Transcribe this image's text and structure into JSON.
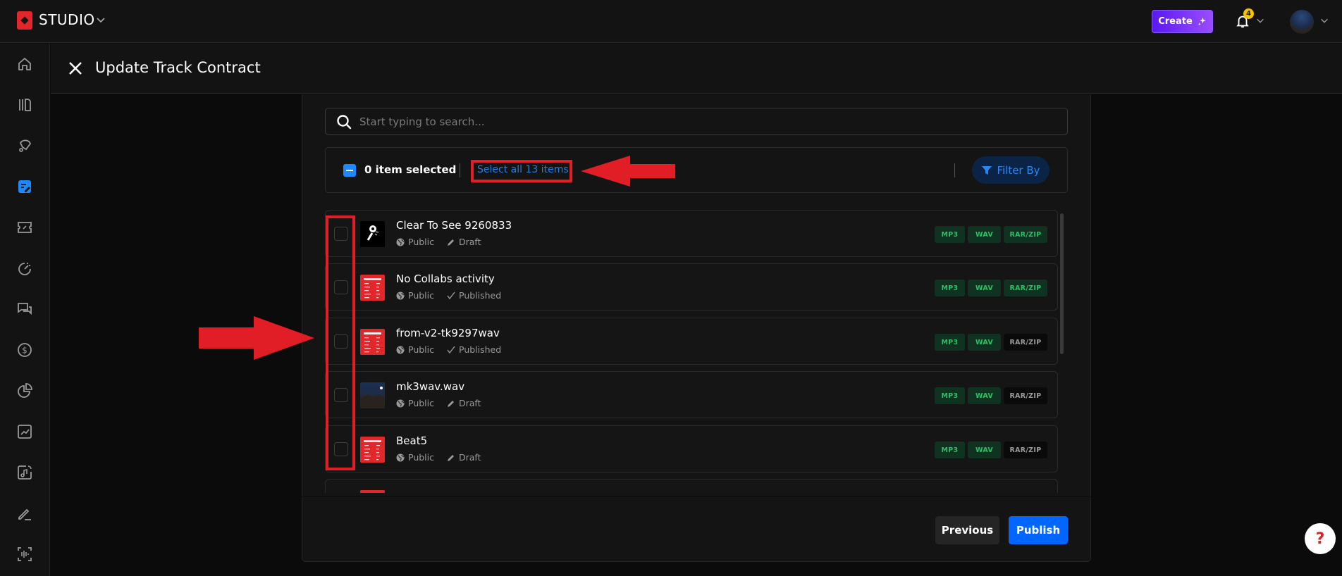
{
  "topbar": {
    "brand": "STUDIO",
    "create_label": "Create",
    "notification_count": "4"
  },
  "sidebar": {
    "items": [
      {
        "name": "home",
        "active": false
      },
      {
        "name": "library",
        "active": false
      },
      {
        "name": "promote",
        "active": false
      },
      {
        "name": "contracts",
        "active": true
      },
      {
        "name": "discounts",
        "active": false
      },
      {
        "name": "analytics",
        "active": false
      },
      {
        "name": "messages",
        "active": false
      },
      {
        "name": "sales",
        "active": false
      },
      {
        "name": "reports",
        "active": false
      },
      {
        "name": "growth",
        "active": false
      },
      {
        "name": "music",
        "active": false
      },
      {
        "name": "edit",
        "active": false
      },
      {
        "name": "audio-scan",
        "active": false
      }
    ]
  },
  "page": {
    "title": "Update Track Contract"
  },
  "search": {
    "placeholder": "Start typing to search...",
    "value": ""
  },
  "toolbar": {
    "selected_count_label": "0 item selected",
    "select_all_label": "Select all 13 items",
    "filter_label": "Filter By"
  },
  "tracks": [
    {
      "title": "Clear To See 9260833",
      "visibility": "Public",
      "status": "Draft",
      "status_icon": "pencil",
      "thumb": "mic",
      "formats": [
        {
          "label": "MP3",
          "on": true
        },
        {
          "label": "WAV",
          "on": true
        },
        {
          "label": "RAR/ZIP",
          "on": true
        }
      ]
    },
    {
      "title": "No Collabs activity",
      "visibility": "Public",
      "status": "Published",
      "status_icon": "check",
      "thumb": "red",
      "formats": [
        {
          "label": "MP3",
          "on": true
        },
        {
          "label": "WAV",
          "on": true
        },
        {
          "label": "RAR/ZIP",
          "on": true
        }
      ]
    },
    {
      "title": "from-v2-tk9297wav",
      "visibility": "Public",
      "status": "Published",
      "status_icon": "check",
      "thumb": "red",
      "formats": [
        {
          "label": "MP3",
          "on": true
        },
        {
          "label": "WAV",
          "on": true
        },
        {
          "label": "RAR/ZIP",
          "on": false
        }
      ]
    },
    {
      "title": "mk3wav.wav",
      "visibility": "Public",
      "status": "Draft",
      "status_icon": "pencil",
      "thumb": "night",
      "formats": [
        {
          "label": "MP3",
          "on": true
        },
        {
          "label": "WAV",
          "on": true
        },
        {
          "label": "RAR/ZIP",
          "on": false
        }
      ]
    },
    {
      "title": "Beat5",
      "visibility": "Public",
      "status": "Draft",
      "status_icon": "pencil",
      "thumb": "red",
      "formats": [
        {
          "label": "MP3",
          "on": true
        },
        {
          "label": "WAV",
          "on": true
        },
        {
          "label": "RAR/ZIP",
          "on": false
        }
      ]
    }
  ],
  "footer": {
    "previous_label": "Previous",
    "publish_label": "Publish"
  },
  "help": {
    "label": "?"
  },
  "colors": {
    "accent_blue": "#0066ff",
    "annotation_red": "#e11d25",
    "format_on": "#2fbf66",
    "brand_red": "#e2272b"
  }
}
